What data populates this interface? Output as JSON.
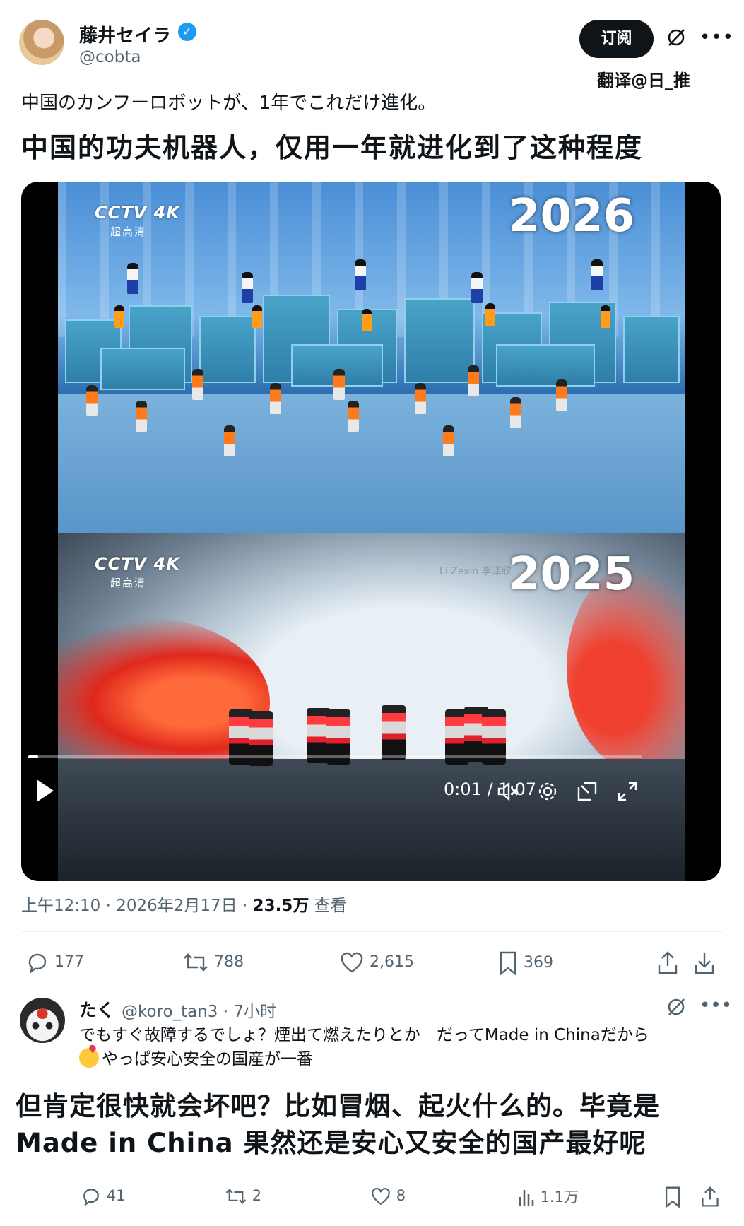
{
  "author": {
    "name": "藤井セイラ",
    "handle": "@cobta",
    "verified": true
  },
  "header": {
    "subscribe_label": "订阅",
    "translator_credit": "翻译@日_推"
  },
  "post": {
    "text_original": "中国のカンフーロボットが、1年でこれだけ進化。",
    "text_translation": "中国的功夫机器人，仅用一年就进化到了这种程度"
  },
  "video": {
    "top_year": "2026",
    "bottom_year": "2025",
    "channel_logo": "CCTV 4K",
    "channel_sub": "超高清",
    "watermark": "Li Zexin 李泽欣",
    "time_display": "0:01 / 1:07",
    "progress_fraction": 0.016
  },
  "meta": {
    "time": "上午12:10",
    "date": "2026年2月17日",
    "views": "23.5万",
    "views_label": "查看"
  },
  "actions": {
    "replies": "177",
    "retweets": "788",
    "likes": "2,615",
    "bookmarks": "369"
  },
  "reply": {
    "name": "たく",
    "handle": "@koro_tan3",
    "time": "7小时",
    "text_line1": "でもすぐ故障するでしょ？煙出て燃えたりとか　だってMade in Chinaだから",
    "text_line2": "やっぱ安心安全の国産が一番",
    "translation_line1": "但肯定很快就会坏吧？比如冒烟、起火什么的。毕竟是",
    "translation_line2": "Made in China 果然还是安心又安全的国产最好呢",
    "replies": "41",
    "retweets": "2",
    "likes": "8",
    "views": "1.1万"
  },
  "colors": {
    "text_primary": "#0f1419",
    "text_secondary": "#536471",
    "verified_blue": "#1d9bf0"
  }
}
